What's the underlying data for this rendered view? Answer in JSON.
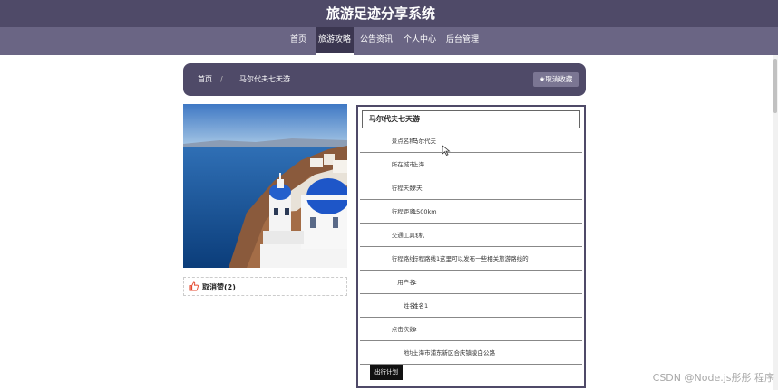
{
  "header": {
    "title": "旅游足迹分享系统"
  },
  "nav": {
    "items": [
      "首页",
      "旅游攻略",
      "公告资讯",
      "个人中心",
      "后台管理"
    ],
    "active": "旅游攻略"
  },
  "breadcrumb": {
    "home": "首页",
    "separator": "/",
    "current": "马尔代夫七天游"
  },
  "favorite": {
    "label": "取消收藏",
    "icon": "star-icon"
  },
  "like": {
    "label": "取消赞(2)",
    "icon": "thumbs-up-icon"
  },
  "detail": {
    "title": "马尔代夫七天游",
    "fields": [
      {
        "label": "景点名称:",
        "value": "马尔代夫"
      },
      {
        "label": "所在城市:",
        "value": "上海"
      },
      {
        "label": "行程天数:",
        "value": "7天"
      },
      {
        "label": "行程距离:",
        "value": "1500km"
      },
      {
        "label": "交通工具:",
        "value": "飞机"
      },
      {
        "label": "行程路线:",
        "value": "行程路线1这里可以发布一些相关旅游路线的"
      },
      {
        "label": "用户名:",
        "value": "1"
      },
      {
        "label": "姓名:",
        "value": "姓名1"
      },
      {
        "label": "点击次数:",
        "value": "9"
      },
      {
        "label": "地址:",
        "value": "上海市浦东新区合庆镇凌白公路"
      }
    ],
    "trip_button": "出行计划"
  },
  "watermark": "CSDN @Node.js彤彤 程序",
  "colors": {
    "primary": "#4f4a68",
    "nav": "#6a6584",
    "nav_active": "#3b3650"
  }
}
